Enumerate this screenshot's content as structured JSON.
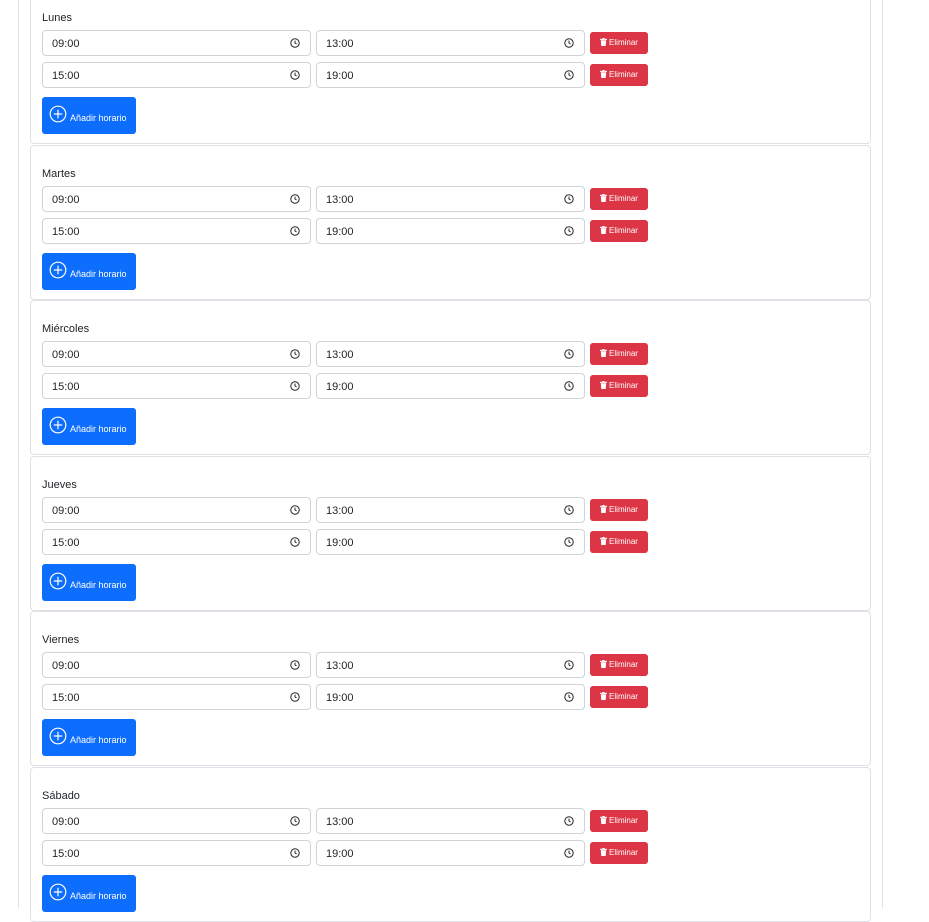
{
  "schedule": {
    "add_label": "Añadir horario",
    "delete_label": "Eliminar",
    "days": [
      {
        "name": "Lunes",
        "slots": [
          {
            "start": "09:00",
            "end": "13:00"
          },
          {
            "start": "15:00",
            "end": "19:00"
          }
        ]
      },
      {
        "name": "Martes",
        "slots": [
          {
            "start": "09:00",
            "end": "13:00"
          },
          {
            "start": "15:00",
            "end": "19:00"
          }
        ]
      },
      {
        "name": "Miércoles",
        "slots": [
          {
            "start": "09:00",
            "end": "13:00"
          },
          {
            "start": "15:00",
            "end": "19:00"
          }
        ]
      },
      {
        "name": "Jueves",
        "slots": [
          {
            "start": "09:00",
            "end": "13:00"
          },
          {
            "start": "15:00",
            "end": "19:00"
          }
        ]
      },
      {
        "name": "Viernes",
        "slots": [
          {
            "start": "09:00",
            "end": "13:00"
          },
          {
            "start": "15:00",
            "end": "19:00"
          }
        ]
      },
      {
        "name": "Sábado",
        "slots": [
          {
            "start": "09:00",
            "end": "13:00"
          },
          {
            "start": "15:00",
            "end": "19:00"
          }
        ]
      }
    ]
  },
  "colors": {
    "primary": "#0d6efd",
    "danger": "#dc3545",
    "border": "#dee2e6",
    "input_border": "#ced4da"
  },
  "icons": {
    "time_field": "clock-icon",
    "delete": "trash-icon",
    "add": "plus-circle-icon"
  }
}
